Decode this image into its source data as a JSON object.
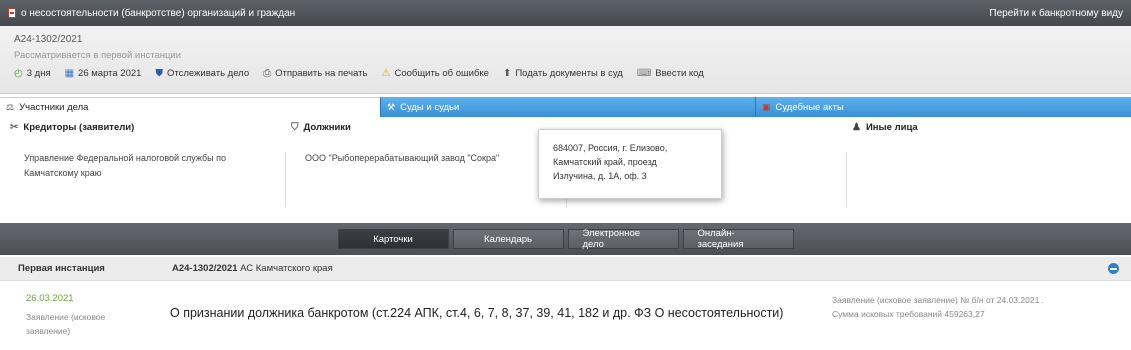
{
  "topbar": {
    "title": "о несостоятельности (банкротстве) организаций и граждан",
    "switch_link": "Перейти к банкротному виду"
  },
  "case": {
    "number": "А24-1302/2021",
    "status": "Рассматривается в первой инстанции"
  },
  "toolbar": {
    "items": [
      {
        "label": "3 дня",
        "icon": "clock-icon"
      },
      {
        "label": "26 марта 2021",
        "icon": "calendar-icon"
      },
      {
        "label": "Отслеживать дело",
        "icon": "shield-icon"
      },
      {
        "label": "Отправить на печать",
        "icon": "printer-icon"
      },
      {
        "label": "Сообщить об ошибке",
        "icon": "warning-icon"
      },
      {
        "label": "Подать документы в суд",
        "icon": "upload-icon"
      },
      {
        "label": "Ввести код",
        "icon": "keyboard-icon"
      }
    ]
  },
  "tabs": {
    "participants": "Участники дела",
    "courts": "Суды и судьи",
    "acts": "Судебные акты"
  },
  "parties": {
    "creditors_title": "Кредиторы (заявители)",
    "creditors_line1": "Управление Федеральной налоговой службы по",
    "creditors_line2": "Камчатскому краю",
    "debtors_title": "Должники",
    "debtor_name": "ООО \"Рыбоперерабатывающий завод \"Сокра\"",
    "others_title": "Иные лица"
  },
  "tooltip": {
    "line1": "684007, Россия, г. Елизово,",
    "line2": "Камчатский край, проезд",
    "line3": "Излучина, д. 1А, оф. 3"
  },
  "bottom_tabs": [
    "Карточки",
    "Календарь",
    "Электронное дело",
    "Онлайн-заседания"
  ],
  "instance": {
    "label": "Первая инстанция",
    "case_number": "А24-1302/2021",
    "court": " АС Камчатского края"
  },
  "entry": {
    "date": "26.03.2021",
    "type_line1": "Заявление (исковое",
    "type_line2": "заявление)",
    "subject": "О признании должника банкротом (ст.224 АПК, ст.4, 6, 7, 8, 37, 39, 41, 182 и др. ФЗ О несостоятельности)",
    "meta_line1": "Заявление (исковое заявление) № б/н от 24.03.2021 .",
    "meta_line2": "Сумма исковых требований 459263,27"
  },
  "colors": {
    "topbar": "#4f5359",
    "tab_blue": "#3a8fd6",
    "date_green": "#6aa83a",
    "collapse_blue": "#2f7fd1"
  }
}
